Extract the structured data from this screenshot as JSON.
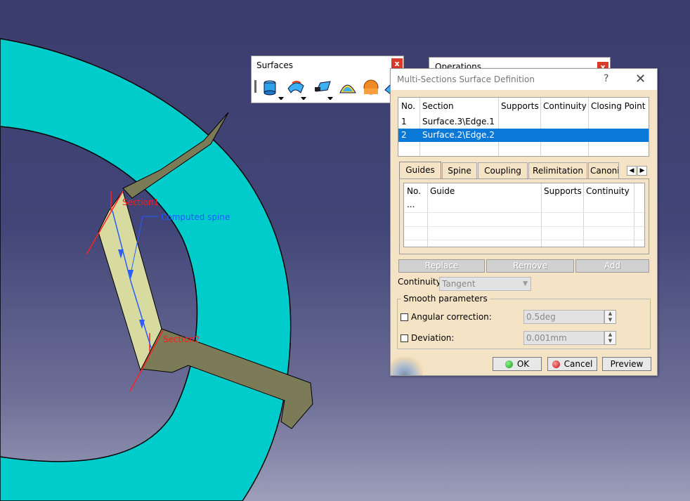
{
  "viewport": {
    "annotations": {
      "section1": "Section1",
      "section2": "Section2",
      "spine": "Computed spine"
    },
    "colors": {
      "ring": "#00cccc",
      "part": "#7a7a55",
      "section_face": "#d6d89a",
      "section_label": "#ff1a1a",
      "spine_label": "#1a5cff"
    }
  },
  "surfaces_toolbar": {
    "title": "Surfaces",
    "close": "x",
    "icons": [
      "extrude-icon",
      "revolve-icon",
      "sphere-icon",
      "cylinder-icon",
      "fill-icon",
      "sweep-icon"
    ]
  },
  "operations_toolbar": {
    "title": "Operations",
    "close": "x"
  },
  "dialog": {
    "title": "Multi-Sections Surface Definition",
    "help": "?",
    "close": "✕",
    "sections": {
      "columns": [
        "No.",
        "Section",
        "Supports",
        "Continuity",
        "Closing Point"
      ],
      "rows": [
        {
          "no": "1",
          "section": "Surface.3\\Edge.1",
          "supports": "",
          "continuity": "",
          "closing_point": ""
        },
        {
          "no": "2",
          "section": "Surface.2\\Edge.2",
          "supports": "",
          "continuity": "",
          "closing_point": ""
        }
      ],
      "selected_row": 2
    },
    "tabs": [
      "Guides",
      "Spine",
      "Coupling",
      "Relimitation",
      "Canonic"
    ],
    "active_tab": "Guides",
    "guides": {
      "columns": [
        "No.",
        "Guide",
        "Supports",
        "Continuity"
      ],
      "rows": [
        {
          "no": "...",
          "guide": "",
          "supports": "",
          "continuity": ""
        }
      ]
    },
    "buttons": {
      "replace": "Replace",
      "remove": "Remove",
      "add": "Add"
    },
    "continuity": {
      "label": "Continuity:",
      "value": "Tangent"
    },
    "smooth": {
      "legend": "Smooth parameters",
      "angular_label": "Angular correction:",
      "angular_value": "0.5deg",
      "angular_checked": false,
      "deviation_label": "Deviation:",
      "deviation_value": "0.001mm",
      "deviation_checked": false
    },
    "actions": {
      "ok": "OK",
      "cancel": "Cancel",
      "preview": "Preview"
    }
  }
}
